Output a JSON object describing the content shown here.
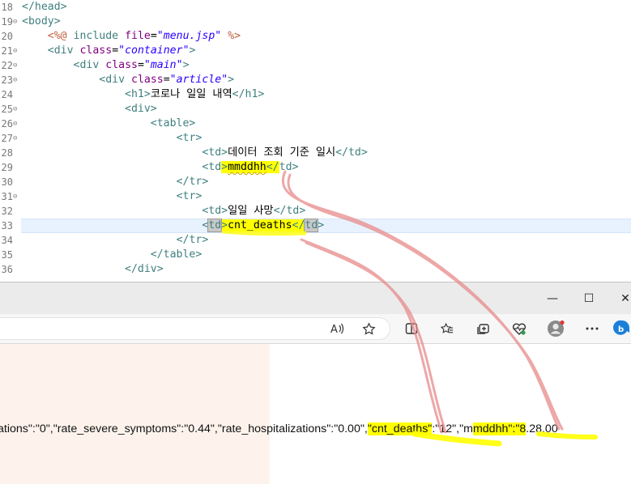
{
  "editor": {
    "lines": [
      {
        "num": "18",
        "fold": "",
        "code": "</head>"
      },
      {
        "num": "19",
        "fold": "⊖",
        "code": "<body>"
      },
      {
        "num": "20",
        "fold": "",
        "code": "    <%@ include file=\"menu.jsp\" %>"
      },
      {
        "num": "21",
        "fold": "⊖",
        "code": "    <div class=\"container\">"
      },
      {
        "num": "22",
        "fold": "⊖",
        "code": "        <div class=\"main\">"
      },
      {
        "num": "23",
        "fold": "⊖",
        "code": "            <div class=\"article\">"
      },
      {
        "num": "24",
        "fold": "",
        "code": "                <h1>코로나 일일 내역</h1>"
      },
      {
        "num": "25",
        "fold": "⊖",
        "code": "                <div>"
      },
      {
        "num": "26",
        "fold": "⊖",
        "code": "                    <table>"
      },
      {
        "num": "27",
        "fold": "⊖",
        "code": "                        <tr>"
      },
      {
        "num": "28",
        "fold": "",
        "code": "                            <td>데이터 조회 기준 일시</td>"
      },
      {
        "num": "29",
        "fold": "",
        "code": "                            <td>mmddhh</td>"
      },
      {
        "num": "30",
        "fold": "",
        "code": "                        </tr>"
      },
      {
        "num": "31",
        "fold": "⊖",
        "code": "                        <tr>"
      },
      {
        "num": "32",
        "fold": "",
        "code": "                            <td>일일 사망</td>"
      },
      {
        "num": "33",
        "fold": "",
        "code": "                            <td>cnt_deaths</td>"
      },
      {
        "num": "34",
        "fold": "",
        "code": "                        </tr>"
      },
      {
        "num": "35",
        "fold": "",
        "code": "                    </table>"
      },
      {
        "num": "36",
        "fold": "",
        "code": "                </div>"
      }
    ],
    "tokens": {
      "include_file": "menu.jsp",
      "class_container": "container",
      "class_main": "main",
      "class_article": "article",
      "h1_text": "코로나 일일 내역",
      "td_label_1": "데이터 조회 기준 일시",
      "td_value_1": "mmddhh",
      "td_label_2": "일일 사망",
      "td_value_2": "cnt_deaths"
    }
  },
  "browser": {
    "window_controls": {
      "minimize": "—",
      "maximize": "☐",
      "close": "✕"
    },
    "toolbar_icons": [
      "read-aloud-icon",
      "favorite-star-icon",
      "split-screen-icon",
      "favorites-icon",
      "collections-icon",
      "browser-essentials-icon",
      "profile-icon",
      "more-icon",
      "bing-icon"
    ],
    "response_text": {
      "part1": "ations\":\"0\",\"rate_severe_symptoms\":\"0.44\",\"rate_hospitalizations\":\"0.00\"",
      "comma1": ",",
      "cnt_deaths_key": "\"cnt_deaths\"",
      "cnt_deaths_colon": ":\"",
      "cnt_deaths_value": "12\"",
      "comma2": ",\"",
      "mmddhh_pre": "m",
      "mmddhh_key": "mddhh\":\"",
      "mmddhh_value": "8",
      "tail": ".28.00"
    }
  },
  "colors": {
    "highlight": "#ffff00",
    "annotation_stroke": "#e88a8a",
    "content_panel": "#fdf3ec"
  }
}
